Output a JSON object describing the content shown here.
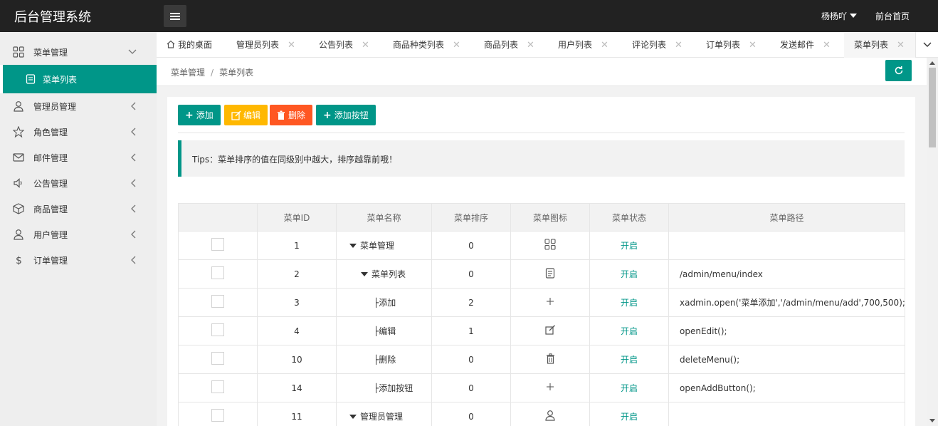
{
  "app": {
    "title": "后台管理系统"
  },
  "header": {
    "user": "杨杨吖",
    "front_link": "前台首页"
  },
  "sidebar": {
    "items": [
      {
        "label": "菜单管理",
        "icon": "grid-icon"
      },
      {
        "label": "管理员管理",
        "icon": "user-icon"
      },
      {
        "label": "角色管理",
        "icon": "star-icon"
      },
      {
        "label": "邮件管理",
        "icon": "mail-icon"
      },
      {
        "label": "公告管理",
        "icon": "speaker-icon"
      },
      {
        "label": "商品管理",
        "icon": "box-icon"
      },
      {
        "label": "用户管理",
        "icon": "user-icon"
      },
      {
        "label": "订单管理",
        "icon": "dollar-icon"
      }
    ],
    "sub_item": {
      "label": "菜单列表",
      "icon": "document-icon"
    }
  },
  "tabs": [
    {
      "label": "我的桌面"
    },
    {
      "label": "管理员列表"
    },
    {
      "label": "公告列表"
    },
    {
      "label": "商品种类列表"
    },
    {
      "label": "商品列表"
    },
    {
      "label": "用户列表"
    },
    {
      "label": "评论列表"
    },
    {
      "label": "订单列表"
    },
    {
      "label": "发送邮件"
    },
    {
      "label": "菜单列表"
    }
  ],
  "breadcrumb": {
    "parent": "菜单管理",
    "sep": "/",
    "current": "菜单列表"
  },
  "toolbar": {
    "add": "添加",
    "edit": "编辑",
    "delete": "删除",
    "add_button": "添加按钮"
  },
  "tips": "Tips：菜单排序的值在同级别中越大，排序越靠前哦！",
  "table": {
    "headers": [
      "",
      "菜单ID",
      "菜单名称",
      "菜单排序",
      "菜单图标",
      "菜单状态",
      "菜单路径"
    ],
    "rows": [
      {
        "id": "1",
        "name": "菜单管理",
        "prefix": "tri",
        "indent": 0,
        "sort": "0",
        "icon": "grid-icon",
        "status": "开启",
        "path": ""
      },
      {
        "id": "2",
        "name": "菜单列表",
        "prefix": "tri",
        "indent": 1,
        "sort": "0",
        "icon": "document-icon",
        "status": "开启",
        "path": "/admin/menu/index"
      },
      {
        "id": "3",
        "name": "├添加",
        "prefix": "",
        "indent": 2,
        "sort": "2",
        "icon": "plus-icon",
        "status": "开启",
        "path": "xadmin.open('菜单添加','/admin/menu/add',700,500);"
      },
      {
        "id": "4",
        "name": "├编辑",
        "prefix": "",
        "indent": 2,
        "sort": "1",
        "icon": "edit-icon",
        "status": "开启",
        "path": "openEdit();"
      },
      {
        "id": "10",
        "name": "├删除",
        "prefix": "",
        "indent": 2,
        "sort": "0",
        "icon": "trash-icon",
        "status": "开启",
        "path": "deleteMenu();"
      },
      {
        "id": "14",
        "name": "├添加按钮",
        "prefix": "",
        "indent": 2,
        "sort": "0",
        "icon": "plus-icon",
        "status": "开启",
        "path": "openAddButton();"
      },
      {
        "id": "11",
        "name": "管理员管理",
        "prefix": "tri",
        "indent": 0,
        "sort": "0",
        "icon": "user-icon",
        "status": "开启",
        "path": ""
      }
    ]
  },
  "colors": {
    "accent": "#009688",
    "header_bg": "#222222",
    "warm": "#FFB800",
    "danger": "#FF5722"
  }
}
